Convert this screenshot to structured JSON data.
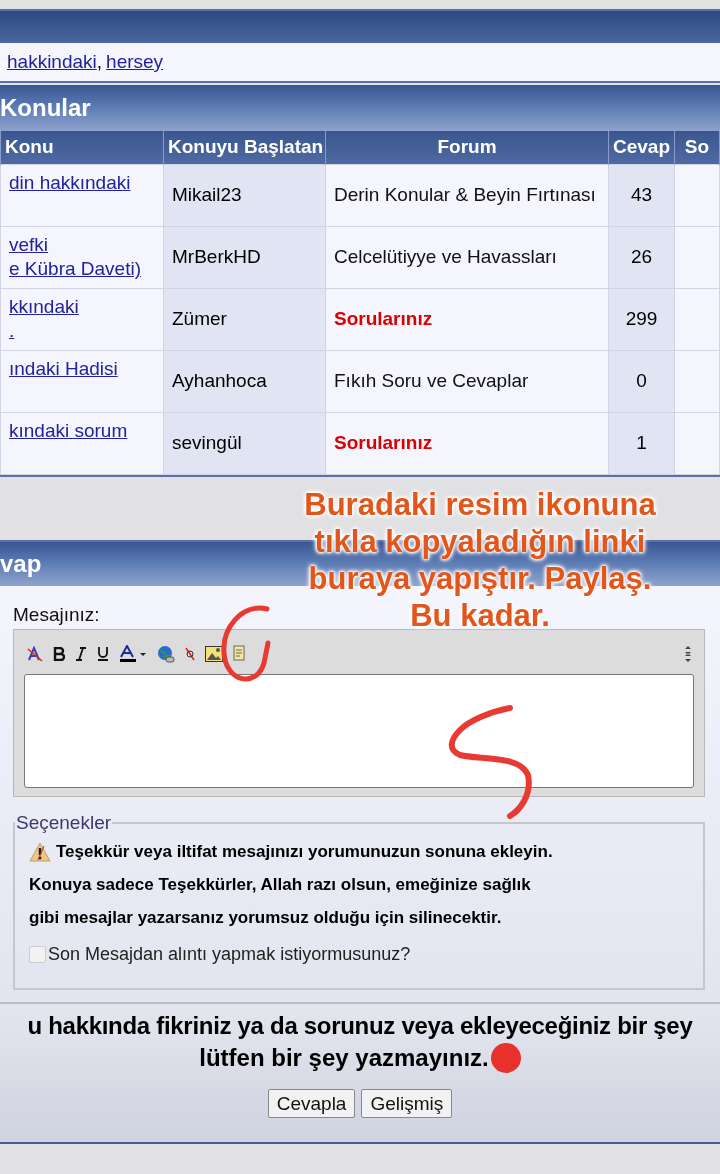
{
  "top_links": [
    {
      "label": "hakkindaki"
    },
    {
      "label": "hersey"
    }
  ],
  "top_links_separator": ",",
  "topics_panel": {
    "title": "Konular",
    "columns": [
      "Konu",
      "Konuyu Başlatan",
      "Forum",
      "Cevap",
      "So"
    ],
    "rows": [
      {
        "topic": [
          "din hakkındaki"
        ],
        "starter": "Mikail23",
        "forum": "Derin Konular & Beyin Fırtınası",
        "forum_highlighted": false,
        "replies": "43"
      },
      {
        "topic": [
          "vefki",
          "e Kübra Daveti)"
        ],
        "starter": "MrBerkHD",
        "forum": "Celcelütiyye ve Havassları",
        "forum_highlighted": false,
        "replies": "26"
      },
      {
        "topic": [
          "kkındaki",
          "."
        ],
        "starter": "Zümer",
        "forum": "Sorularınız",
        "forum_highlighted": true,
        "replies": "299"
      },
      {
        "topic": [
          "ındaki Hadisi"
        ],
        "starter": "Ayhanhoca",
        "forum": "Fıkıh Soru ve Cevaplar",
        "forum_highlighted": false,
        "replies": "0"
      },
      {
        "topic": [
          "kındaki sorum"
        ],
        "starter": "sevingül",
        "forum": "Sorularınız",
        "forum_highlighted": true,
        "replies": "1"
      }
    ]
  },
  "reply_panel": {
    "title": "vap",
    "message_label": "Mesajınız:",
    "options": {
      "legend": "Seçenekler",
      "notice": [
        "Teşekkür veya iltifat mesajınızı yorumunuzun sonuna ekleyin.",
        "Konuya sadece Teşekkürler, Allah razı olsun, emeğinize sağlık",
        "gibi mesajlar yazarsanız yorumsuz olduğu için silinecektir."
      ],
      "quote_checkbox": {
        "label": "Son Mesajdan alıntı yapmak istiyormusunuz?",
        "checked": false
      }
    }
  },
  "notice": [
    "u hakkında fikriniz ya da sorunuz veya ekleyeceğiniz bir şey",
    "lütfen bir şey yazmayınız."
  ],
  "buttons": [
    "Cevapla",
    "Gelişmiş"
  ],
  "annotation": {
    "lines": [
      "Buradaki resim ikonuna",
      "tıkla kopyaladığın linki",
      "buraya yapıştır. Paylaş.",
      "Bu kadar."
    ]
  }
}
